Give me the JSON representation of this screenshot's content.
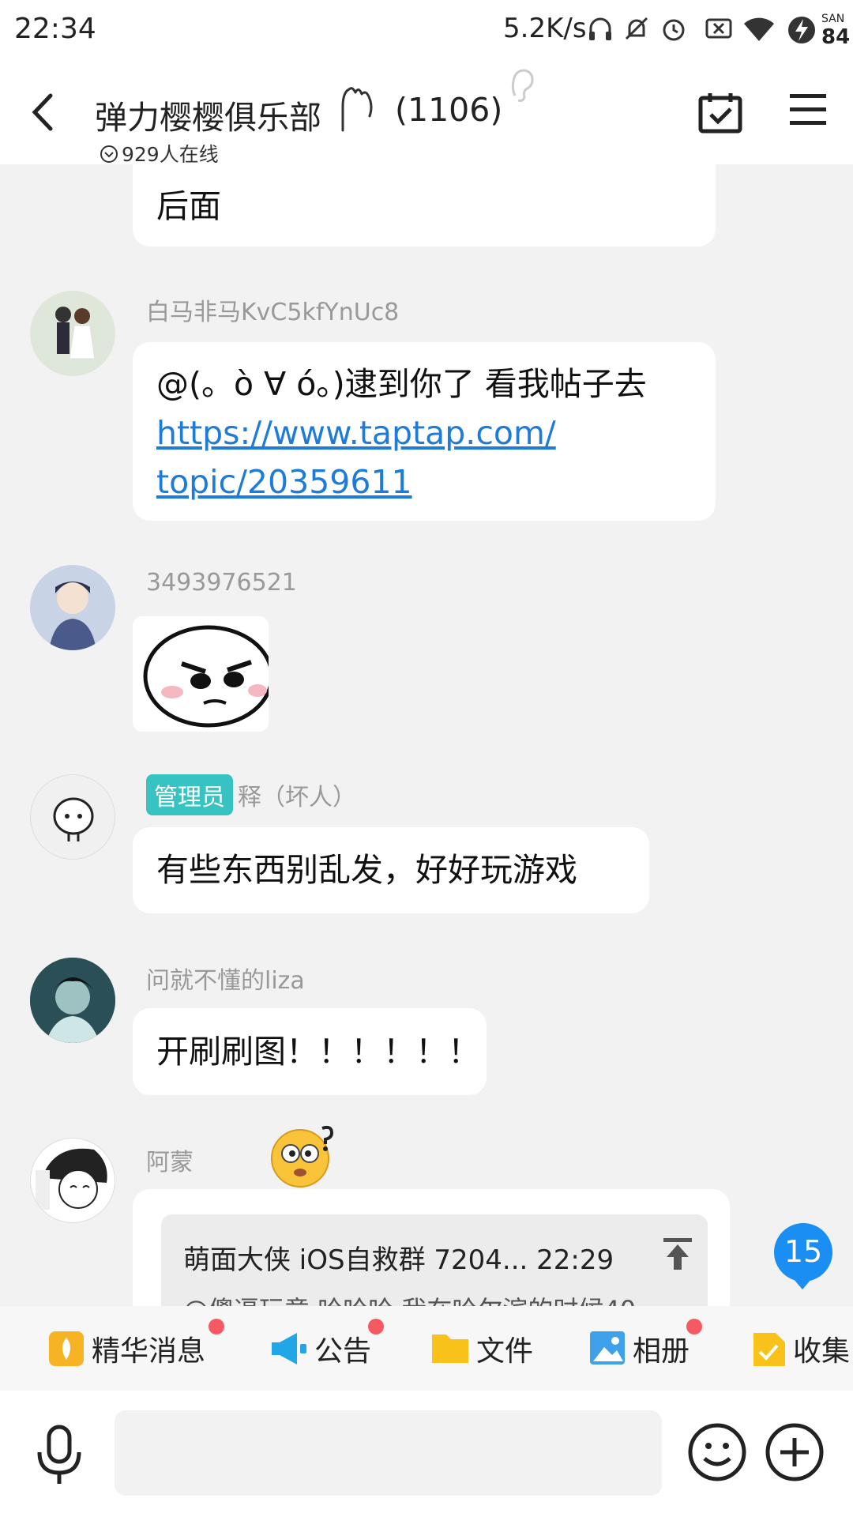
{
  "status_bar": {
    "time": "22:34",
    "net_speed": "5.2K/s",
    "icons": [
      "headphones-icon",
      "bell-off-icon",
      "alarm-icon",
      "sim-off-icon",
      "wifi-icon",
      "lightning-icon"
    ],
    "san_label": "SAN",
    "battery": "84"
  },
  "header": {
    "group_name": "弹力樱樱俱乐部",
    "member_count": "(1106)",
    "online_text": "929人在线"
  },
  "messages": [
    {
      "partial_text": "后面"
    },
    {
      "sender": "白马非马KvC5kfYnUc8",
      "text_before": "@(。ò ∀ ó。)逮到你了  看我帖子去",
      "link_line1": "https://www.taptap.com/",
      "link_line2": "topic/20359611"
    },
    {
      "sender": "3493976521",
      "sticker": "angry-face-sticker"
    },
    {
      "admin_tag": "管理员",
      "sender": "释（坏人）",
      "text": "有些东西别乱发，好好玩游戏"
    },
    {
      "sender": "问就不懂的liza",
      "text": "开刷刷图！！！！！！"
    },
    {
      "sender": "阿蒙",
      "quote_title": "萌面大侠 iOS自救群 7204... 22:29",
      "quote_text": "@傻逼玩意 哈哈哈 我在哈尔滨的时候40"
    }
  ],
  "unread_badge": "15",
  "toolbar": [
    {
      "label": "精华消息",
      "icon": "essence-icon",
      "dot": true
    },
    {
      "label": "公告",
      "icon": "megaphone-icon",
      "dot": true
    },
    {
      "label": "文件",
      "icon": "folder-icon",
      "dot": false
    },
    {
      "label": "相册",
      "icon": "album-icon",
      "dot": true
    },
    {
      "label": "收集",
      "icon": "collect-icon",
      "dot": false
    }
  ],
  "colors": {
    "accent": "#1a8ef2",
    "admin_tag": "#36c3c1",
    "link": "#1f7bd8",
    "red_dot": "#f55a63"
  }
}
